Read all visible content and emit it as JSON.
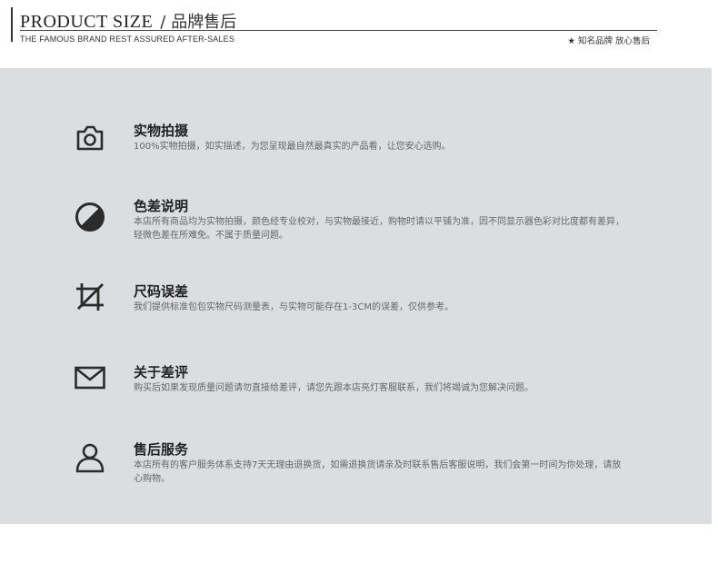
{
  "header": {
    "title_en": "PRODUCT SIZE",
    "separator": "/",
    "title_cn": "品牌售后",
    "subtitle_en": "THE FAMOUS BRAND REST ASSURED AFTER-SALES",
    "subtitle_right": "★ 知名品牌 放心售后"
  },
  "items": [
    {
      "icon": "camera-icon",
      "title": "实物拍摄",
      "desc": "100%实物拍摄，如实描述，为您呈现最自然最真实的产品看，让您安心选购。"
    },
    {
      "icon": "contrast-icon",
      "title": "色差说明",
      "desc": "本店所有商品均为实物拍摄，颜色经专业校对，与实物最接近，购物时请以平铺为准，因不同显示器色彩对比度都有差异，轻微色差在所难免。不属于质量问题。"
    },
    {
      "icon": "crop-icon",
      "title": "尺码误差",
      "desc": "我们提供标准包包实物尺码测量表，与实物可能存在1-3CM的误差，仅供参考。"
    },
    {
      "icon": "mail-icon",
      "title": "关于差评",
      "desc": "购买后如果发现质量问题请勿直接给差评，请您先跟本店亮灯客服联系，我们将竭诚为您解决问题。"
    },
    {
      "icon": "user-icon",
      "title": "售后服务",
      "desc": "本店所有的客户服务体系支持7天无理由退换货，如需退换货请亲及时联系售后客服说明，我们会第一时间为你处理，请放心购物。"
    }
  ]
}
